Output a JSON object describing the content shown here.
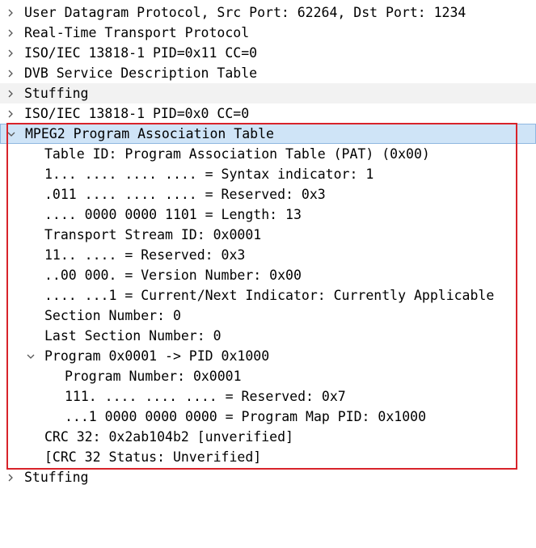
{
  "rows": [
    "User Datagram Protocol, Src Port: 62264, Dst Port: 1234",
    "Real-Time Transport Protocol",
    "ISO/IEC 13818-1 PID=0x11 CC=0",
    "DVB Service Description Table",
    "Stuffing",
    "ISO/IEC 13818-1 PID=0x0 CC=0",
    "MPEG2 Program Association Table",
    "Table ID: Program Association Table (PAT) (0x00)",
    "1... .... .... .... = Syntax indicator: 1",
    ".011 .... .... .... = Reserved: 0x3",
    ".... 0000 0000 1101 = Length: 13",
    "Transport Stream ID: 0x0001",
    "11.. .... = Reserved: 0x3",
    "..00 000. = Version Number: 0x00",
    ".... ...1 = Current/Next Indicator: Currently Applicable",
    "Section Number: 0",
    "Last Section Number: 0",
    "Program 0x0001 -> PID 0x1000",
    "Program Number: 0x0001",
    "111. .... .... .... = Reserved: 0x7",
    "...1 0000 0000 0000 = Program Map PID: 0x1000",
    "CRC 32: 0x2ab104b2 [unverified]",
    "[CRC 32 Status: Unverified]",
    "Stuffing"
  ],
  "colors": {
    "selected_bg": "#cfe4f7",
    "selected_border": "#8fb8e0",
    "alt_row_bg": "#f2f2f2",
    "highlight_box": "#d8232a"
  }
}
